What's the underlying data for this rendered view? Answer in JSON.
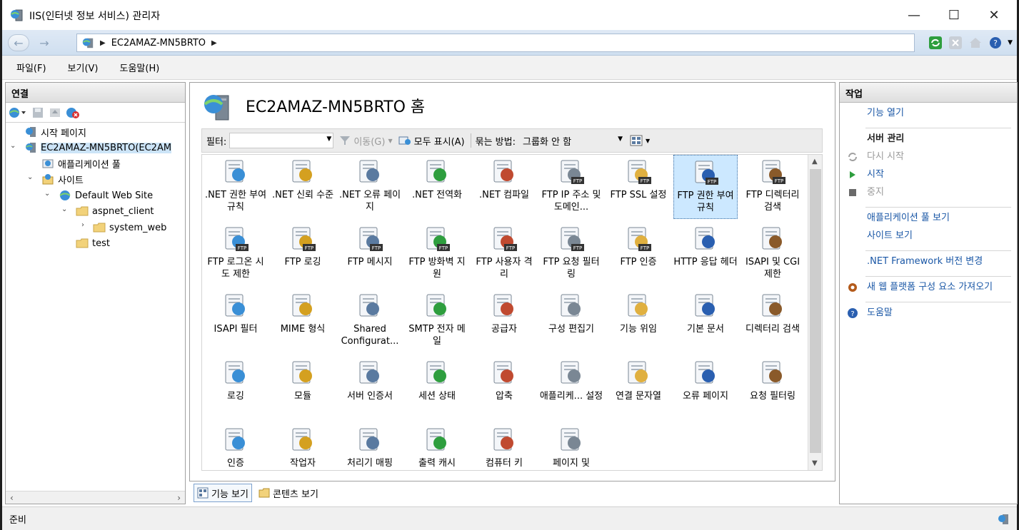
{
  "window": {
    "title": "IIS(인터넷 정보 서비스) 관리자",
    "min": "—",
    "max": "☐",
    "close": "✕"
  },
  "address": {
    "back": "←",
    "forward": "→",
    "crumb": "EC2AMAZ-MN5BRTO",
    "arrow": "▶"
  },
  "menu": [
    "파일(F)",
    "보기(V)",
    "도움말(H)"
  ],
  "connections": {
    "header": "연결",
    "tree": [
      {
        "label": "시작 페이지",
        "icon": "start-page-icon"
      },
      {
        "label": "EC2AMAZ-MN5BRTO(EC2AM",
        "icon": "server-icon"
      },
      {
        "label": "애플리케이션 풀",
        "icon": "app-pool-icon"
      },
      {
        "label": "사이트",
        "icon": "sites-icon"
      },
      {
        "label": "Default Web Site",
        "icon": "website-icon"
      },
      {
        "label": "aspnet_client",
        "icon": "folder-icon"
      },
      {
        "label": "system_web",
        "icon": "folder-icon"
      },
      {
        "label": "test",
        "icon": "folder-icon"
      }
    ]
  },
  "home": {
    "title": "EC2AMAZ-MN5BRTO 홈",
    "filter_label": "필터:",
    "go": "이동(G)",
    "show_all": "모두 표시(A)",
    "group_by": "묶는 방법:",
    "group_value": "그룹화 안 함"
  },
  "features": [
    {
      "label": ".NET 권한 부여 규칙",
      "icon": "lock-doc-icon"
    },
    {
      "label": ".NET 신뢰 수준",
      "icon": "trust-check-icon"
    },
    {
      "label": ".NET 오류 페이지",
      "icon": "error-page-icon"
    },
    {
      "label": ".NET 전역화",
      "icon": "globe-icon"
    },
    {
      "label": ".NET 컴파일",
      "icon": "compile-icon"
    },
    {
      "label": "FTP IP 주소 및 도메인...",
      "icon": "ftp-ip-icon"
    },
    {
      "label": "FTP SSL 설정",
      "icon": "ftp-ssl-lock-icon"
    },
    {
      "label": "FTP 권한 부여 규칙",
      "icon": "ftp-keys-icon"
    },
    {
      "label": "FTP 디렉터리 검색",
      "icon": "ftp-browse-icon"
    },
    {
      "label": "FTP 로그온 시도 제한",
      "icon": "ftp-logon-icon"
    },
    {
      "label": "FTP 로깅",
      "icon": "ftp-log-icon"
    },
    {
      "label": "FTP 메시지",
      "icon": "ftp-message-icon"
    },
    {
      "label": "FTP 방화벽 지원",
      "icon": "ftp-firewall-icon"
    },
    {
      "label": "FTP 사용자 격리",
      "icon": "ftp-user-isolation-icon"
    },
    {
      "label": "FTP 요청 필터링",
      "icon": "ftp-request-filter-icon"
    },
    {
      "label": "FTP 인증",
      "icon": "ftp-auth-icon"
    },
    {
      "label": "HTTP 응답 헤더",
      "icon": "http-headers-icon"
    },
    {
      "label": "ISAPI 및 CGI 제한",
      "icon": "cgi-icon"
    },
    {
      "label": "ISAPI 필터",
      "icon": "funnel-icon"
    },
    {
      "label": "MIME 형식",
      "icon": "mime-icon"
    },
    {
      "label": "Shared Configurat...",
      "icon": "shared-config-icon"
    },
    {
      "label": "SMTP 전자 메일",
      "icon": "smtp-mail-icon"
    },
    {
      "label": "공급자",
      "icon": "providers-icon"
    },
    {
      "label": "구성 편집기",
      "icon": "config-editor-icon"
    },
    {
      "label": "기능 위임",
      "icon": "delegation-icon"
    },
    {
      "label": "기본 문서",
      "icon": "default-doc-icon"
    },
    {
      "label": "디렉터리 검색",
      "icon": "dir-browse-icon"
    },
    {
      "label": "로깅",
      "icon": "logging-icon"
    },
    {
      "label": "모듈",
      "icon": "modules-icon"
    },
    {
      "label": "서버 인증서",
      "icon": "certificates-icon"
    },
    {
      "label": "세션 상태",
      "icon": "session-state-icon"
    },
    {
      "label": "압축",
      "icon": "compression-icon"
    },
    {
      "label": "애플리케... 설정",
      "icon": "app-settings-icon"
    },
    {
      "label": "연결 문자열",
      "icon": "connection-strings-icon"
    },
    {
      "label": "오류 페이지",
      "icon": "error-pages-icon"
    },
    {
      "label": "요청 필터링",
      "icon": "request-filter-icon"
    },
    {
      "label": "인증",
      "icon": "authentication-icon"
    },
    {
      "label": "작업자",
      "icon": "worker-processes-icon"
    },
    {
      "label": "처리기 매핑",
      "icon": "handler-mappings-icon"
    },
    {
      "label": "출력 캐시",
      "icon": "output-cache-icon"
    },
    {
      "label": "컴퓨터 키",
      "icon": "machine-key-icon"
    },
    {
      "label": "페이지 및",
      "icon": "pages-controls-icon"
    }
  ],
  "view_tabs": {
    "features": "기능 보기",
    "content": "콘텐츠 보기"
  },
  "actions": {
    "header": "작업",
    "open_feature": "기능 열기",
    "manage_server": "서버 관리",
    "restart": "다시 시작",
    "start": "시작",
    "stop": "중지",
    "view_app_pools": "애플리케이션 풀 보기",
    "view_sites": "사이트 보기",
    "net_version": ".NET Framework 버전 변경",
    "get_components": "새 웹 플랫폼 구성 요소 가져오기",
    "help": "도움말"
  },
  "status": {
    "text": "준비"
  },
  "colors": {
    "link": "#1a57a6",
    "selection": "#cce8ff",
    "accent": "#3a6ea5"
  }
}
